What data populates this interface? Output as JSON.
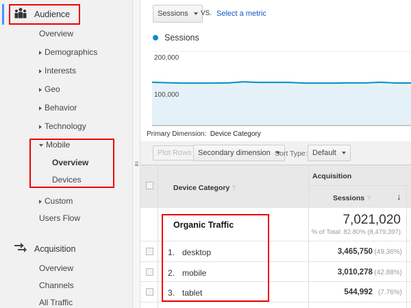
{
  "sidebar": {
    "audience": {
      "label": "Audience",
      "icon": "audience-icon"
    },
    "items": [
      {
        "label": "Overview",
        "arrow": "none"
      },
      {
        "label": "Demographics",
        "arrow": "right"
      },
      {
        "label": "Interests",
        "arrow": "right"
      },
      {
        "label": "Geo",
        "arrow": "right"
      },
      {
        "label": "Behavior",
        "arrow": "right"
      },
      {
        "label": "Technology",
        "arrow": "right"
      },
      {
        "label": "Mobile",
        "arrow": "down"
      }
    ],
    "mobile_sub": [
      {
        "label": "Overview",
        "active": true
      },
      {
        "label": "Devices",
        "active": false
      }
    ],
    "items2": [
      {
        "label": "Custom",
        "arrow": "right"
      },
      {
        "label": "Users Flow",
        "arrow": "none"
      }
    ],
    "acquisition": {
      "label": "Acquisition",
      "icon": "acquisition-icon"
    },
    "acq_items": [
      "Overview",
      "Channels",
      "All Traffic"
    ]
  },
  "toolbar_top": {
    "metric": "Sessions",
    "vs": "VS.",
    "select_metric": "Select a metric"
  },
  "chart_data": {
    "type": "area",
    "legend": "Sessions",
    "series_color": "#058dc7",
    "fill_color": "#e5f1f8",
    "ylim": [
      0,
      200000
    ],
    "yticks": [
      "200,000",
      "100,000"
    ],
    "values": [
      117000,
      115500,
      114500,
      114500,
      114500,
      115000,
      118000,
      116500,
      116500,
      116500,
      114500,
      114500,
      114500,
      115000,
      115000,
      116800,
      114800,
      114800
    ]
  },
  "primary_dimension": {
    "label": "Primary Dimension:",
    "value": "Device Category"
  },
  "controls": {
    "plot_rows": "Plot Rows",
    "secondary": "Secondary dimension",
    "sort_label": "Sort Type:",
    "sort_value": "Default"
  },
  "table": {
    "group_header": "Acquisition",
    "col_dimension": "Device Category",
    "col_sessions": "Sessions",
    "segment": "Organic Traffic",
    "total": "7,021,020",
    "total_sub": "% of Total: 82.80% (8,479,397)",
    "rows": [
      {
        "idx": "1.",
        "name": "desktop",
        "sessions": "3,465,750",
        "pct": "(49.36%)"
      },
      {
        "idx": "2.",
        "name": "mobile",
        "sessions": "3,010,278",
        "pct": "(42.88%)"
      },
      {
        "idx": "3.",
        "name": "tablet",
        "sessions": "544,992",
        "pct": "(7.76%)"
      }
    ]
  },
  "highlight_color": "#e00000"
}
